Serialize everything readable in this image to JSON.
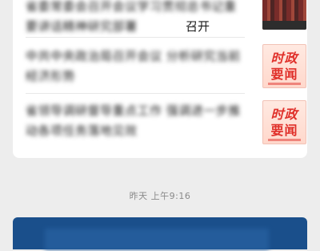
{
  "feed": {
    "articles": [
      {
        "title_blurred": "省委常委会召开会议学习贯彻总书记重要讲话精神研究部署",
        "title_visible_tail": "召开",
        "thumb": "news-photo"
      },
      {
        "title_blurred": "中共中央政治局召开会议 分析研究当前经济形势",
        "title_visible_tail": "",
        "thumb": "brand"
      },
      {
        "title_blurred": "省领导调研督导重点工作 强调进一步推动各项任务落地见效",
        "title_visible_tail": "",
        "thumb": "brand"
      }
    ],
    "brand_thumb": {
      "line1": "时政",
      "line2": "要闻"
    }
  },
  "timestamp": "昨天 上午9:16",
  "colors": {
    "accent_red": "#e0302a",
    "next_card": "#1a4f8b"
  }
}
